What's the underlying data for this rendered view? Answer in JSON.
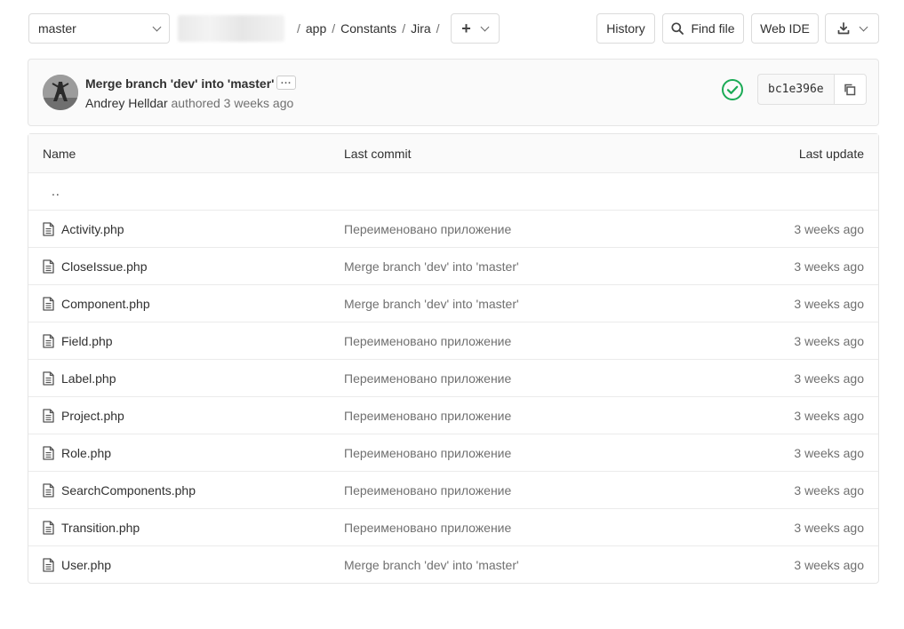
{
  "branch": {
    "name": "master"
  },
  "breadcrumb": {
    "items": [
      "app",
      "Constants",
      "Jira"
    ],
    "separator": "/"
  },
  "buttons": {
    "history": "History",
    "find_file": "Find file",
    "web_ide": "Web IDE"
  },
  "commit": {
    "title": "Merge branch 'dev' into 'master'",
    "author": "Andrey Helldar",
    "meta": "authored 3 weeks ago",
    "sha": "bc1e396e",
    "status_color": "#1aaa55"
  },
  "table": {
    "headers": {
      "name": "Name",
      "last_commit": "Last commit",
      "last_update": "Last update"
    },
    "parent_link": "..",
    "rows": [
      {
        "name": "Activity.php",
        "commit": "Переименовано приложение",
        "updated": "3 weeks ago"
      },
      {
        "name": "CloseIssue.php",
        "commit": "Merge branch 'dev' into 'master'",
        "updated": "3 weeks ago"
      },
      {
        "name": "Component.php",
        "commit": "Merge branch 'dev' into 'master'",
        "updated": "3 weeks ago"
      },
      {
        "name": "Field.php",
        "commit": "Переименовано приложение",
        "updated": "3 weeks ago"
      },
      {
        "name": "Label.php",
        "commit": "Переименовано приложение",
        "updated": "3 weeks ago"
      },
      {
        "name": "Project.php",
        "commit": "Переименовано приложение",
        "updated": "3 weeks ago"
      },
      {
        "name": "Role.php",
        "commit": "Переименовано приложение",
        "updated": "3 weeks ago"
      },
      {
        "name": "SearchComponents.php",
        "commit": "Переименовано приложение",
        "updated": "3 weeks ago"
      },
      {
        "name": "Transition.php",
        "commit": "Переименовано приложение",
        "updated": "3 weeks ago"
      },
      {
        "name": "User.php",
        "commit": "Merge branch 'dev' into 'master'",
        "updated": "3 weeks ago"
      }
    ]
  },
  "icons": {
    "branch_dropdown": "chevron-down-icon",
    "add": "plus-icon",
    "find": "search-icon",
    "download": "download-icon",
    "pipeline": "check-circle-icon",
    "copy": "copy-icon",
    "file": "file-icon"
  }
}
